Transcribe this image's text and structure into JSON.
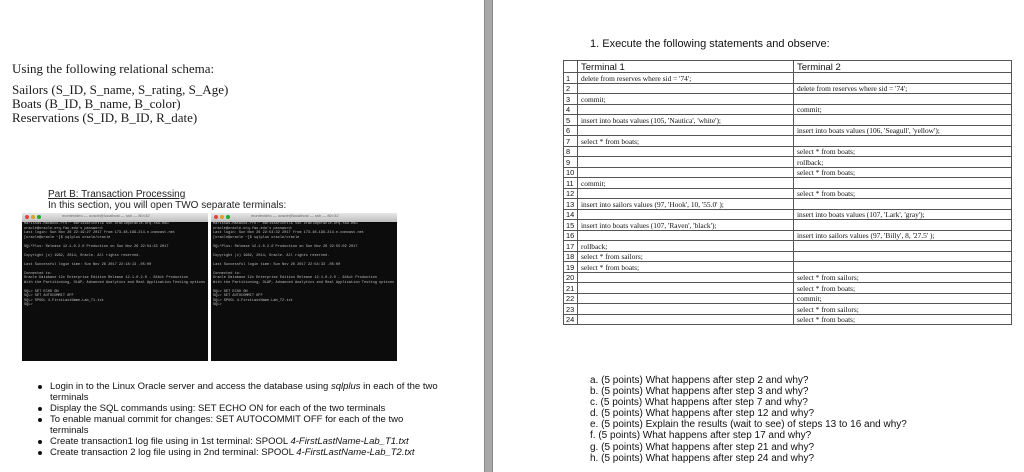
{
  "left_page": {
    "schema_intro": "Using the following relational schema:",
    "schema_lines": [
      "Sailors (S_ID, S_name, S_rating, S_Age)",
      "Boats (B_ID, B_name, B_color)",
      "Reservations (S_ID, B_ID, R_date)"
    ],
    "part_b_title": "Part B: Transaction Processing",
    "part_b_text": "In this section, you will open TWO separate terminals:",
    "terminal1": {
      "title": "montevideo — oracle@localhost — ssh — 80×32",
      "lines": [
        "Marissas-MacBook-Pro:~ marissafichtl$ ssh oracle@oracle.orq.fau.edu",
        "oracle@oracle.orq.fau.edu's password:",
        "Last login: Sun Nov 26 22:19:27 2017 from 173-48-199-214.n.comcast.net",
        "[oracle@oracle ~]$ sqlplus oracle/oracle",
        "",
        "SQL*Plus: Release 12.1.0.2.0 Production on Sun Nov 26 22:54:33 2017",
        "",
        "Copyright (c) 1982, 2014, Oracle.  All rights reserved.",
        "",
        "Last Successful login time: Sun Nov 26 2017 22:18:13 -05:00",
        "",
        "Connected to:",
        "Oracle Database 12c Enterprise Edition Release 12.1.0.2.0 - 64bit Production",
        "With the Partitioning, OLAP, Advanced Analytics and Real Application Testing options",
        "",
        "SQL> SET ECHO ON",
        "SQL> SET AUTOCOMMIT OFF",
        "SQL> SPOOL 4-FirstLastName-Lab_T1.txt",
        "SQL>"
      ]
    },
    "terminal2": {
      "title": "montevideo — oracle@localhost — ssh — 80×32",
      "lines": [
        "Marissas-MacBook-Pro:~ marissafichtl$ ssh oracle@oracle.orq.fau.edu",
        "oracle@oracle.orq.fau.edu's password:",
        "Last login: Sun Nov 26 22:54:32 2017 from 173-48-199-214.n.comcast.net",
        "[oracle@oracle ~]$ sqlplus oracle/oracle",
        "",
        "SQL*Plus: Release 12.1.0.2.0 Production on Sun Nov 26 22:55:02 2017",
        "",
        "Copyright (c) 1982, 2014, Oracle.  All rights reserved.",
        "",
        "Last Successful login time: Sun Nov 26 2017 22:54:33 -05:00",
        "",
        "Connected to:",
        "Oracle Database 12c Enterprise Edition Release 12.1.0.2.0 - 64bit Production",
        "With the Partitioning, OLAP, Advanced Analytics and Real Application Testing options",
        "",
        "SQL> SET ECHO ON",
        "SQL> SET AUTOCOMMIT OFF",
        "SQL> SPOOL 4-FirstLastName-Lab_T2.txt",
        "SQL>"
      ]
    },
    "bullets": [
      {
        "text": "Login in to the Linux Oracle server and access the database using ",
        "em": "sqlplus",
        "after": " in each of the two terminals"
      },
      {
        "text": "Display the SQL commands using: SET ECHO ON for each of the two terminals",
        "em": "",
        "after": ""
      },
      {
        "text": "To enable manual commit for changes:  SET AUTOCOMMIT OFF for each of the two terminals",
        "em": "",
        "after": ""
      },
      {
        "text": "Create transaction1 log file using in 1st terminal:  SPOOL ",
        "em": "4-FirstLastName-Lab_T1.txt",
        "after": ""
      },
      {
        "text": "Create transaction 2 log file using in 2nd terminal:  SPOOL ",
        "em": "4-FirstLastName-Lab_T2.txt",
        "after": ""
      }
    ]
  },
  "right_page": {
    "task_title": "1.  Execute the following statements and observe:",
    "table": {
      "headers": [
        "",
        "Terminal 1",
        "Terminal 2"
      ],
      "rows": [
        [
          "1",
          "delete from reserves where sid = '74';",
          ""
        ],
        [
          "2",
          "",
          "delete from reserves where sid = '74';"
        ],
        [
          "3",
          "commit;",
          ""
        ],
        [
          "4",
          "",
          "commit;"
        ],
        [
          "5",
          "insert into boats values (105, 'Nautica', 'white');",
          ""
        ],
        [
          "6",
          "",
          "insert into boats values (106, 'Seagull', 'yellow');"
        ],
        [
          "7",
          "select * from boats;",
          ""
        ],
        [
          "8",
          "",
          "select * from boats;"
        ],
        [
          "9",
          "",
          "rollback;"
        ],
        [
          "10",
          "",
          "select * from boats;"
        ],
        [
          "11",
          "commit;",
          ""
        ],
        [
          "12",
          "",
          "select * from boats;"
        ],
        [
          "13",
          "insert into sailors values (97, 'Hook', 10, '55.0' );",
          ""
        ],
        [
          "14",
          "",
          "insert into boats values (107, 'Lark', 'gray');"
        ],
        [
          "15",
          "insert into boats values (107, 'Raven', 'black');",
          ""
        ],
        [
          "16",
          "",
          "insert into sailors values (97, 'Billy', 8, '27.5' );"
        ],
        [
          "17",
          "rollback;",
          ""
        ],
        [
          "18",
          "select * from sailors;",
          ""
        ],
        [
          "19",
          "select * from boats;",
          ""
        ],
        [
          "20",
          "",
          "select * from sailors;"
        ],
        [
          "21",
          "",
          "select * from boats;"
        ],
        [
          "22",
          "",
          "commit;"
        ],
        [
          "23",
          "",
          "select * from sailors;"
        ],
        [
          "24",
          "",
          "select * from boats;"
        ]
      ]
    },
    "questions": [
      "a. (5 points) What happens after step 2 and why?",
      "b. (5 points) What happens after step 3 and why?",
      "c. (5 points) What happens after step 7 and why?",
      "d. (5 points) What happens after step 12 and why?",
      "e. (5 points) Explain the results (wait to see) of steps 13 to 16 and why?",
      "f. (5 points) What happens after step 17 and why?",
      "g. (5 points) What happens after step 21 and why?",
      "h. (5 points) What happens after step 24 and why?"
    ]
  }
}
